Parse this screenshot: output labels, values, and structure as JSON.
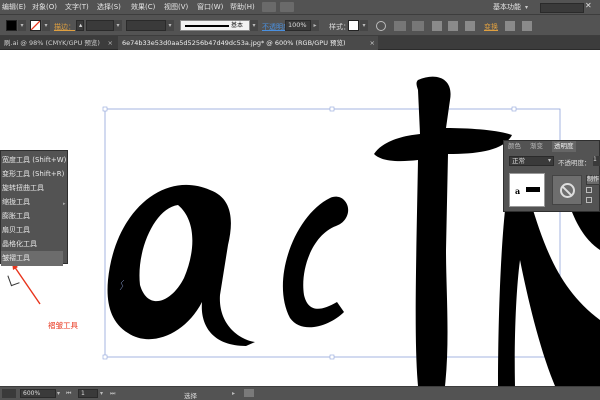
{
  "menubar": {
    "items": [
      "编辑(E)",
      "对象(O)",
      "文字(T)",
      "选择(S)",
      "效果(C)",
      "视图(V)",
      "窗口(W)",
      "帮助(H)"
    ],
    "workspace": "基本功能",
    "search_placeholder": "",
    "minimize": "—",
    "maximize": "☐",
    "close": "✕"
  },
  "controlbar": {
    "stroke_label": "描边：",
    "brush_label": "基本",
    "opacity_label": "不透明度：",
    "opacity_value": "100%",
    "style_label": "样式：",
    "transform_label": "变换"
  },
  "tabs": [
    {
      "label": "刷.ai @ 98% (CMYK/GPU 预览)",
      "active": false
    },
    {
      "label": "6e74b33e53d0aa5d5256b47d49dc53a.jpg* @ 600% (RGB/GPU 预览)",
      "active": true
    }
  ],
  "canvas": {
    "artwork_text": "actN"
  },
  "flyout": {
    "items": [
      "宽度工具 (Shift+W)",
      "变形工具 (Shift+R)",
      "旋转扭曲工具",
      "缩拢工具",
      "膨胀工具",
      "扇贝工具",
      "晶格化工具",
      "皱褶工具"
    ],
    "selected_index": 7
  },
  "annotation": {
    "label": "褶皱工具"
  },
  "transparency_panel": {
    "tabs": [
      "颜色",
      "渐变",
      "透明度"
    ],
    "active_tab": 2,
    "blend_mode": "正常",
    "opacity_label": "不透明度：",
    "opacity_value": "1",
    "make_mask_button": "制作",
    "release_button": "释",
    "invert_button": "反"
  },
  "statusbar": {
    "zoom": "600%",
    "artboard": "1",
    "tool": "选择"
  },
  "colors": {
    "chrome": "#535353",
    "chrome_dark": "#3c3c3c",
    "accent": "#e8341c",
    "guide": "#8fa4d9"
  }
}
